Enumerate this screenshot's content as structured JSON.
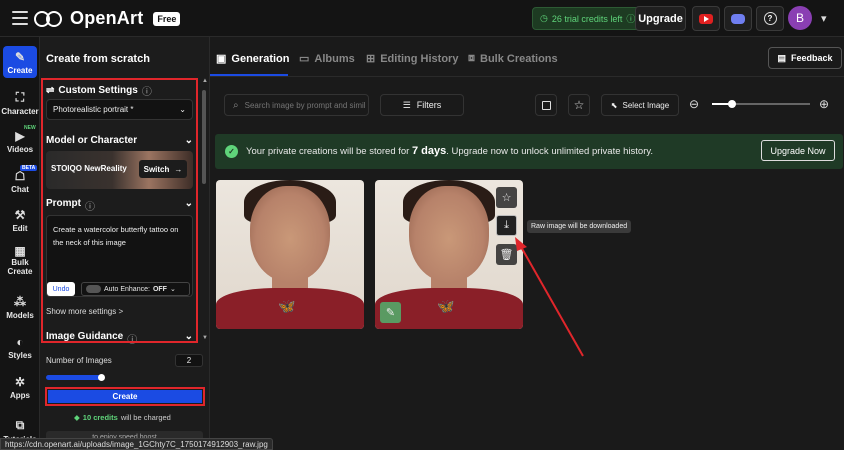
{
  "brand": {
    "name": "OpenArt",
    "plan_badge": "Free"
  },
  "topbar": {
    "credits": "26 trial credits left",
    "upgrade": "Upgrade",
    "avatar_letter": "B"
  },
  "rail": {
    "items": [
      {
        "label": "Create",
        "icon": "edit-icon"
      },
      {
        "label": "Character",
        "icon": "character-icon"
      },
      {
        "label": "Videos",
        "icon": "video-icon",
        "badge": "NEW"
      },
      {
        "label": "Chat",
        "icon": "chat-icon",
        "badge": "BETA"
      },
      {
        "label": "Edit",
        "icon": "edit-tools-icon"
      },
      {
        "label": "Bulk Create",
        "icon": "bulk-icon"
      },
      {
        "label": "Models",
        "icon": "models-icon"
      },
      {
        "label": "Styles",
        "icon": "palette-icon"
      },
      {
        "label": "Apps",
        "icon": "apps-icon"
      },
      {
        "label": "Tutorials",
        "icon": "tutorials-icon"
      }
    ]
  },
  "panel": {
    "title": "Create from scratch",
    "custom_settings": "Custom Settings",
    "preset": "Photorealistic portrait *",
    "model_heading": "Model or Character",
    "model_name": "STOIQO NewReality",
    "switch": "Switch",
    "prompt_heading": "Prompt",
    "prompt_text": "Create a watercolor butterfly tattoo on the neck of this image",
    "undo": "Undo",
    "auto_enhance_label": "Auto Enhance:",
    "auto_enhance_value": "OFF",
    "show_more": "Show more settings >",
    "image_guidance": "Image Guidance",
    "num_images_label": "Number of Images",
    "num_images_value": "2",
    "create": "Create",
    "charge_credits": "10 credits",
    "charge_suffix": "will be charged",
    "partial_text": "to enjoy speed boost"
  },
  "tabs": [
    {
      "label": "Generation",
      "active": true
    },
    {
      "label": "Albums"
    },
    {
      "label": "Editing History"
    },
    {
      "label": "Bulk Creations"
    }
  ],
  "feedback": "Feedback",
  "toolbar": {
    "search_placeholder": "Search image by prompt and similar",
    "filters": "Filters",
    "select_image": "Select Image"
  },
  "banner": {
    "prefix": "Your private creations will be stored for",
    "days": "7 days",
    "suffix": ". Upgrade now to unlock unlimited private history.",
    "button": "Upgrade Now"
  },
  "tooltip": "Raw image will be downloaded",
  "status_url": "https://cdn.openart.ai/uploads/image_1GChty7C_1750174912903_raw.jpg",
  "colors": {
    "accent": "#1b4be3",
    "annotation": "#e0262b",
    "success": "#5fd47a"
  }
}
